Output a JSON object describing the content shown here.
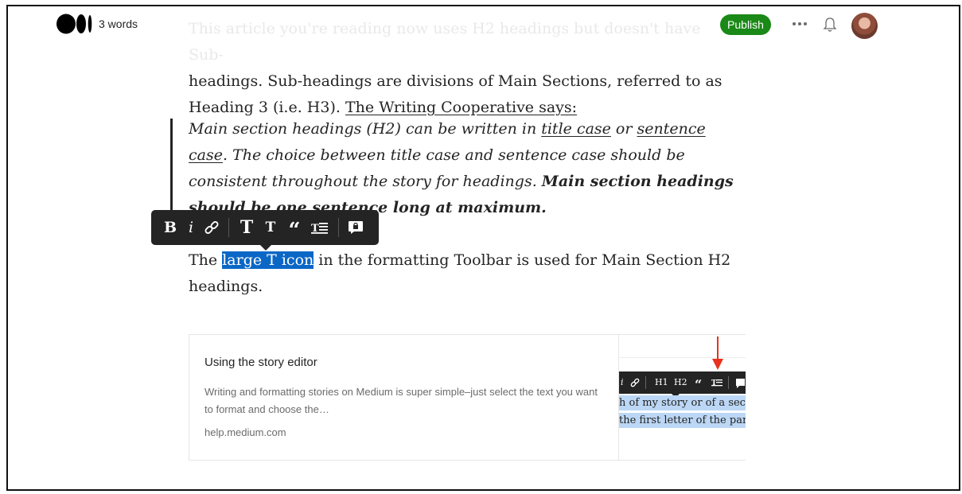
{
  "header": {
    "word_count": "3 words",
    "publish_label": "Publish"
  },
  "article": {
    "para1_faded": "This article you're reading now uses H2 headings but doesn't have Sub-",
    "para1_text": "headings. Sub-headings are divisions of Main Sections, referred to as Heading 3 (i.e. H3). ",
    "para1_link": "The Writing Cooperative says:",
    "quote_part1": "Main section headings (H2) can be written in ",
    "quote_link1": "title case",
    "quote_part2": " or ",
    "quote_link2": "sentence case",
    "quote_part3": ". The choice between title case and sentence case should be consistent throughout the story for headings. ",
    "quote_bold": "Main section headings should be one sentence long at maximum.",
    "para2_before": "The ",
    "para2_selected": "large T icon",
    "para2_after": " in the formatting Toolbar is used for Main Section H2 headings."
  },
  "toolbar": {
    "bold_label": "B",
    "italic_label": "i",
    "large_title_label": "T",
    "small_title_label": "T",
    "quote_label": "“"
  },
  "card": {
    "title": "Using the story editor",
    "description": "Writing and formatting stories on Medium is super simple–just select the text you want to format and choose the…",
    "host": "help.medium.com",
    "image": {
      "toolbar_items": [
        "i",
        "H1",
        "H2",
        "“"
      ],
      "line1": "h of my story or of a section",
      "line2": "the first letter of the paragraph"
    }
  },
  "colors": {
    "publish_green": "#1a8917",
    "selection_blue": "#0b67c6",
    "toolbar_bg": "#242424",
    "arrow_red": "#e8321f"
  }
}
